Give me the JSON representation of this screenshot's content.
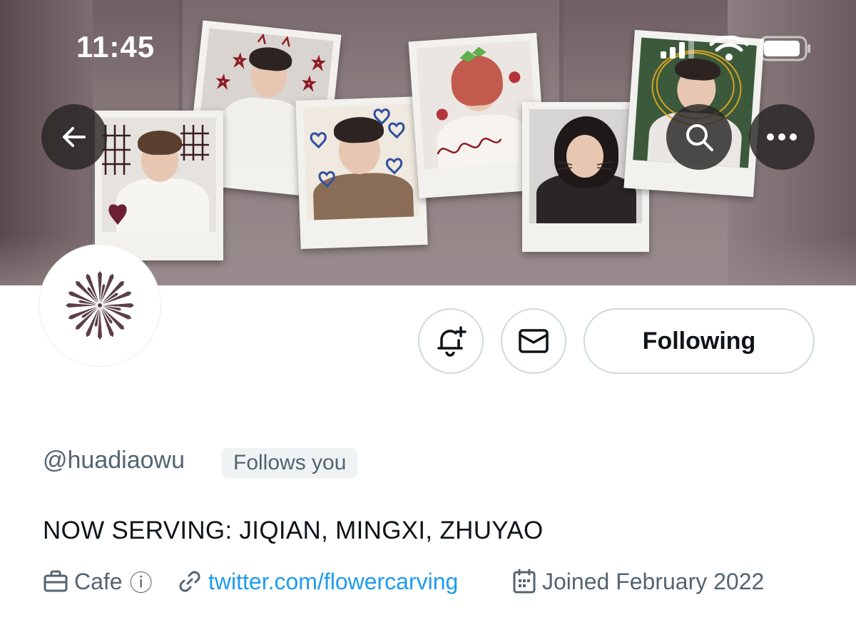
{
  "status_bar": {
    "time": "11:45"
  },
  "nav": {
    "back_label": "Back",
    "search_label": "Search",
    "more_label": "More"
  },
  "actions": {
    "following_label": "Following"
  },
  "profile": {
    "handle": "@huadiaowu",
    "follows_you": "Follows you",
    "bio": "NOW SERVING: JIQIAN, MINGXI, ZHUYAO",
    "category": "Cafe",
    "category_info_icon": "ⓘ",
    "website": "twitter.com/flowercarving",
    "joined": "Joined February 2022"
  },
  "icons": {
    "back": "arrow-left-icon",
    "search": "search-icon",
    "more": "more-horizontal-icon",
    "notify": "bell-plus-icon",
    "message": "envelope-icon",
    "category": "briefcase-icon",
    "website": "link-icon",
    "joined": "calendar-icon",
    "avatar": "flower-logo"
  },
  "colors": {
    "text_primary": "#0f1419",
    "text_secondary": "#536471",
    "link": "#1d9bf0",
    "border": "#cfd9de",
    "badge_bg": "#eff3f4",
    "avatar_flower": "#5b3f44"
  }
}
